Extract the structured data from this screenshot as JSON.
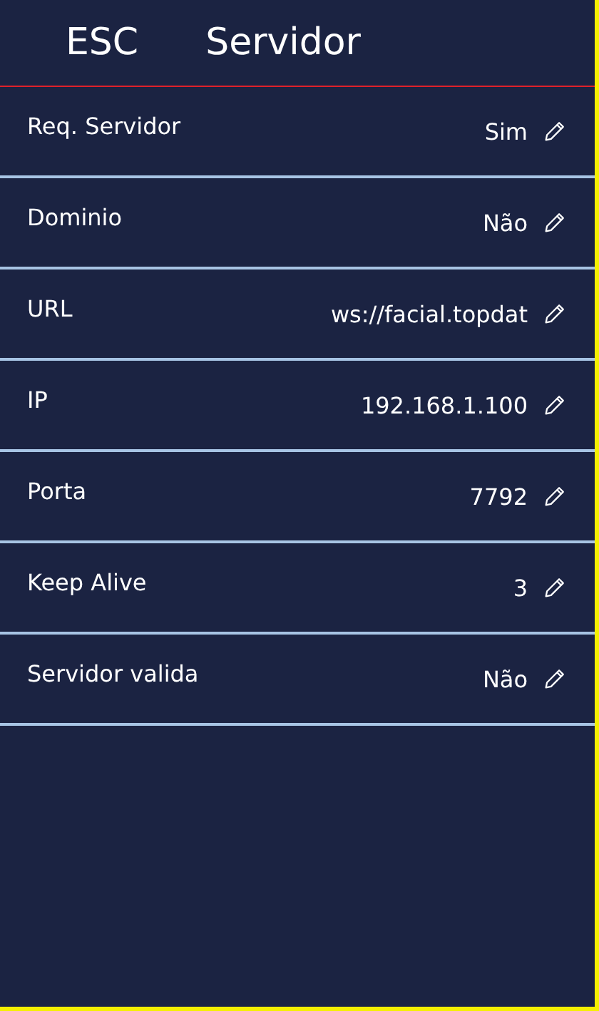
{
  "header": {
    "back": "ESC",
    "title": "Servidor"
  },
  "settings": [
    {
      "label": "Req. Servidor",
      "value": "Sim"
    },
    {
      "label": "Dominio",
      "value": "Não"
    },
    {
      "label": "URL",
      "value": "ws://facial.topdat"
    },
    {
      "label": "IP",
      "value": "192.168.1.100"
    },
    {
      "label": "Porta",
      "value": "7792"
    },
    {
      "label": "Keep Alive",
      "value": "3"
    },
    {
      "label": "Servidor valida",
      "value": "Não"
    }
  ]
}
